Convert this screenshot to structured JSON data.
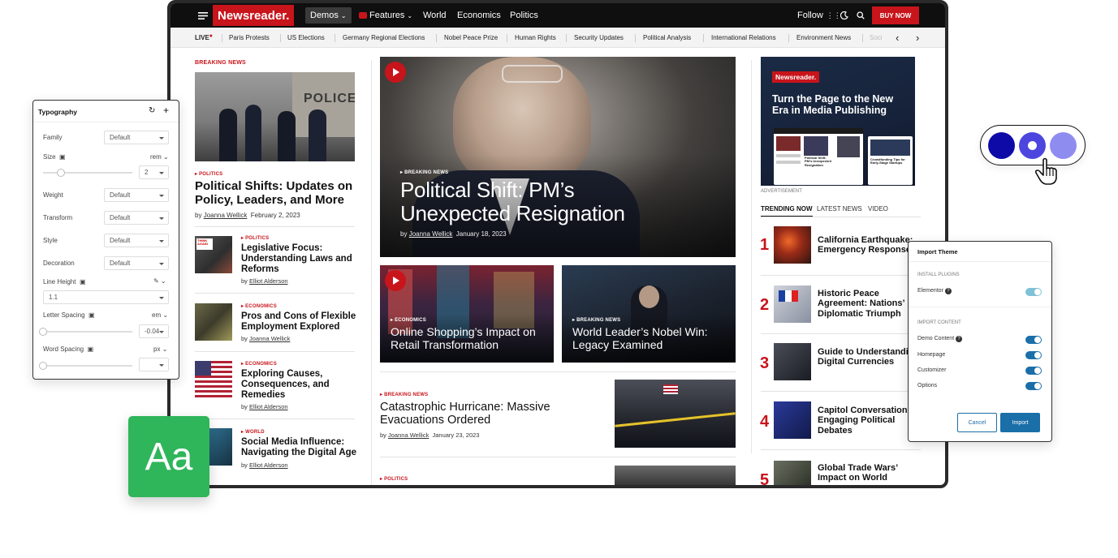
{
  "topbar": {
    "logo": "Newsreader.",
    "demos": "Demos",
    "features": "Features",
    "nav": [
      "World",
      "Economics",
      "Politics"
    ],
    "follow": "Follow",
    "buy_now": "BUY NOW"
  },
  "ticker": {
    "live": "LIVE",
    "items": [
      "Paris Protests",
      "US Elections",
      "Germany Regional Elections",
      "Nobel Peace Prize",
      "Human Rights",
      "Security Updates",
      "Political Analysis",
      "International Relations",
      "Environment News",
      "Soci"
    ]
  },
  "left": {
    "section": "BREAKING NEWS",
    "police_sign": "POLICE",
    "lead": {
      "category": "POLITICS",
      "title": "Political Shifts: Updates on Policy, Leaders, and More",
      "by": "by",
      "author": "Joanna Wellick",
      "date": "February 2, 2023"
    },
    "items": [
      {
        "category": "POLITICS",
        "title": "Legislative Focus: Understanding Laws and Reforms",
        "by": "by",
        "author": "Elliot Alderson",
        "sign": "THINK AGAIN"
      },
      {
        "category": "ECONOMICS",
        "title": "Pros and Cons of Flexible Employment Explored",
        "by": "by",
        "author": "Joanna Wellick"
      },
      {
        "category": "ECONOMICS",
        "title": "Exploring Causes, Consequences, and Remedies",
        "by": "by",
        "author": "Elliot Alderson"
      },
      {
        "category": "WORLD",
        "title": "Social Media Influence: Navigating the Digital Age",
        "by": "by",
        "author": "Elliot Alderson"
      }
    ]
  },
  "center": {
    "hero": {
      "category": "BREAKING NEWS",
      "title": "Political Shift: PM’s Unexpected Resignation",
      "by": "by",
      "author": "Joanna Wellick",
      "date": "January 18, 2023"
    },
    "card1": {
      "category": "ECONOMICS",
      "title": "Online Shopping’s Impact on Retail Transformation"
    },
    "card2": {
      "category": "BREAKING NEWS",
      "title": "World Leader’s Nobel Win: Legacy Examined"
    },
    "story": {
      "category": "BREAKING NEWS",
      "title": "Catastrophic Hurricane: Massive Evacuations Ordered",
      "by": "by",
      "author": "Joanna Wellick",
      "date": "January 23, 2023"
    },
    "story2_category": "POLITICS"
  },
  "right": {
    "ad": {
      "logo": "Newsreader.",
      "headline": "Turn the Page to the New Era in Media Publishing",
      "label": "ADVERTISEMENT",
      "mini_headline": "Political Shift: PM’s Unexpected Resignation",
      "mini_headline2": "Crowdfunding Tips for Early-Stage Startups"
    },
    "tabs": [
      "TRENDING NOW",
      "LATEST NEWS",
      "VIDEO"
    ],
    "trending": [
      {
        "n": "1",
        "title": "California Earthquake: Emergency Response"
      },
      {
        "n": "2",
        "title": "Historic Peace Agreement: Nations’ Diplomatic Triumph"
      },
      {
        "n": "3",
        "title": "Guide to Understanding Digital Currencies"
      },
      {
        "n": "4",
        "title": "Capitol Conversations: Engaging Political Debates"
      },
      {
        "n": "5",
        "title": "Global Trade Wars’ Impact on World"
      }
    ]
  },
  "typography": {
    "title": "Typography",
    "family_label": "Family",
    "family_value": "Default",
    "size_label": "Size",
    "size_unit": "rem",
    "size_value": "2",
    "weight_label": "Weight",
    "weight_value": "Default",
    "transform_label": "Transform",
    "transform_value": "Default",
    "style_label": "Style",
    "style_value": "Default",
    "decoration_label": "Decoration",
    "decoration_value": "Default",
    "line_height_label": "Line Height",
    "line_height_value": "1.1",
    "letter_spacing_label": "Letter Spacing",
    "letter_spacing_unit": "em",
    "letter_spacing_value": "-0.04",
    "word_spacing_label": "Word Spacing",
    "word_spacing_unit": "px"
  },
  "import_theme": {
    "title": "Import Theme",
    "install_plugins": "INSTALL PLUGINS",
    "elementor": "Elementor",
    "import_content": "IMPORT CONTENT",
    "options": [
      "Demo Content",
      "Homepage",
      "Customizer",
      "Options"
    ],
    "cancel": "Cancel",
    "import": "Import"
  },
  "badge": "Aa",
  "colors": {
    "accent": "#c8141b",
    "swatch1": "#0e0aa8",
    "swatch2": "#4c46de",
    "swatch3": "#8f8cf0",
    "green": "#2fb55a"
  }
}
